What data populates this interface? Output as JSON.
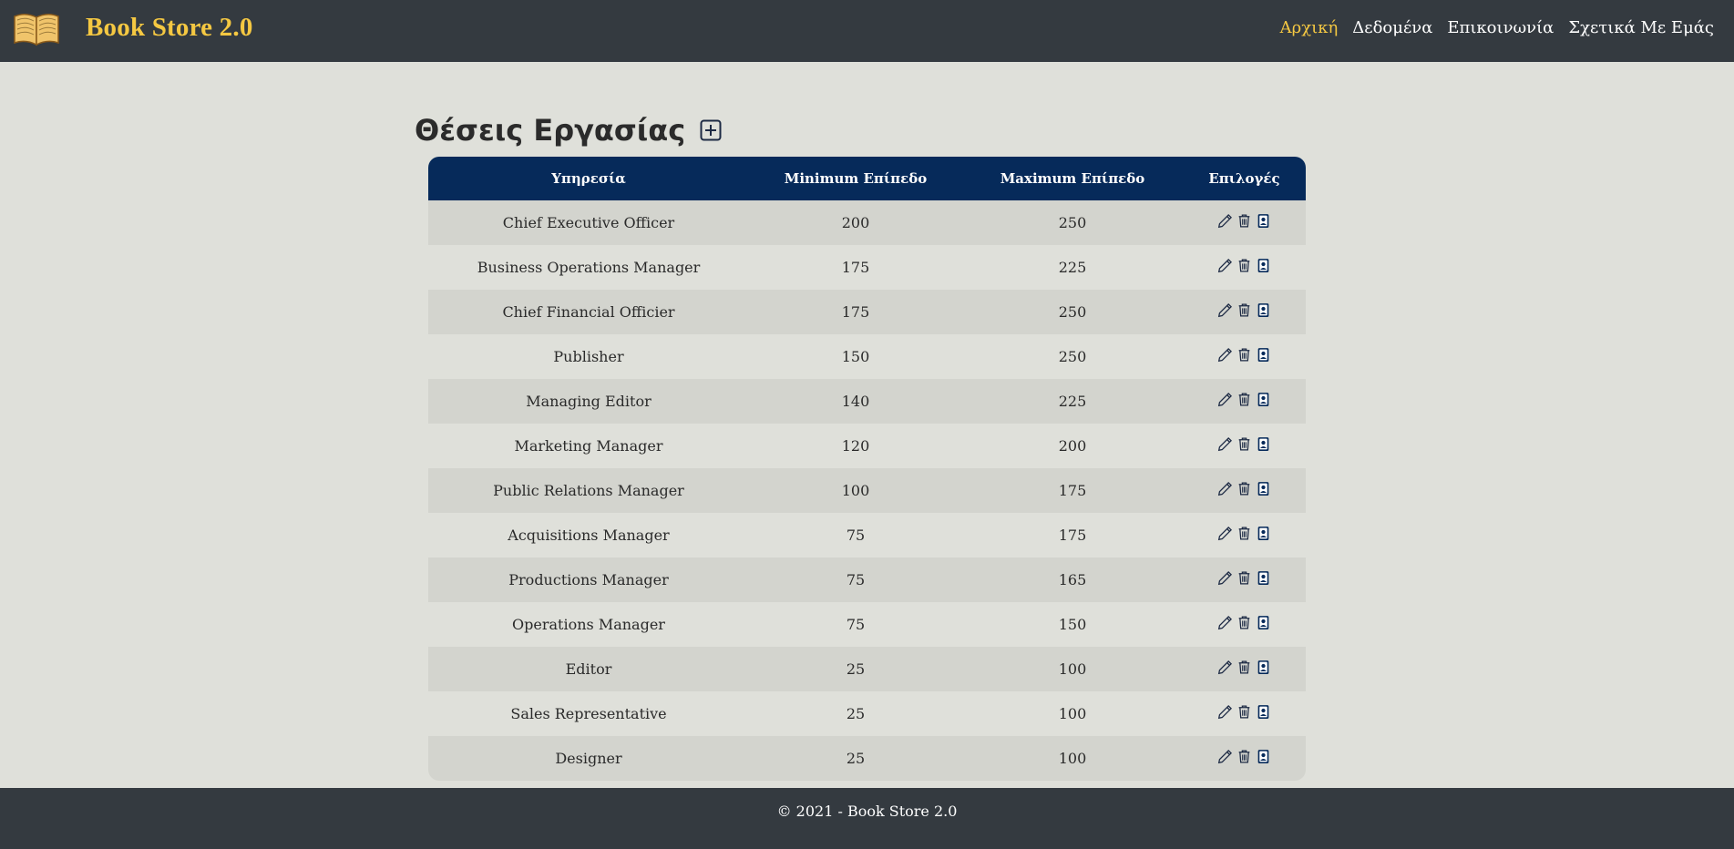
{
  "navbar": {
    "brand": "Book Store 2.0",
    "logo_icon": "open-book-icon",
    "links": [
      {
        "label": "Αρχική",
        "active": true
      },
      {
        "label": "Δεδομένα",
        "active": false
      },
      {
        "label": "Επικοινωνία",
        "active": false
      },
      {
        "label": "Σχετικά Με Εμάς",
        "active": false
      }
    ]
  },
  "page": {
    "title": "Θέσεις Εργασίας",
    "add_icon": "plus-square-icon"
  },
  "table": {
    "headers": [
      "Υπηρεσία",
      "Minimum Επίπεδο",
      "Maximum Επίπεδο",
      "Επιλογές"
    ],
    "row_icons": [
      "pencil-icon",
      "trash-icon",
      "person-badge-icon"
    ],
    "rows": [
      [
        "Chief Executive Officer",
        "200",
        "250"
      ],
      [
        "Business Operations Manager",
        "175",
        "225"
      ],
      [
        "Chief Financial Officier",
        "175",
        "250"
      ],
      [
        "Publisher",
        "150",
        "250"
      ],
      [
        "Managing Editor",
        "140",
        "225"
      ],
      [
        "Marketing Manager",
        "120",
        "200"
      ],
      [
        "Public Relations Manager",
        "100",
        "175"
      ],
      [
        "Acquisitions Manager",
        "75",
        "175"
      ],
      [
        "Productions Manager",
        "75",
        "165"
      ],
      [
        "Operations Manager",
        "75",
        "150"
      ],
      [
        "Editor",
        "25",
        "100"
      ],
      [
        "Sales Representative",
        "25",
        "100"
      ],
      [
        "Designer",
        "25",
        "100"
      ]
    ]
  },
  "footer": {
    "text": "© 2021 - Book Store 2.0"
  },
  "colors": {
    "navbar_bg": "#343a40",
    "brand": "#f5c842",
    "table_header": "#062a5a",
    "page_bg": "#dfe0da"
  }
}
